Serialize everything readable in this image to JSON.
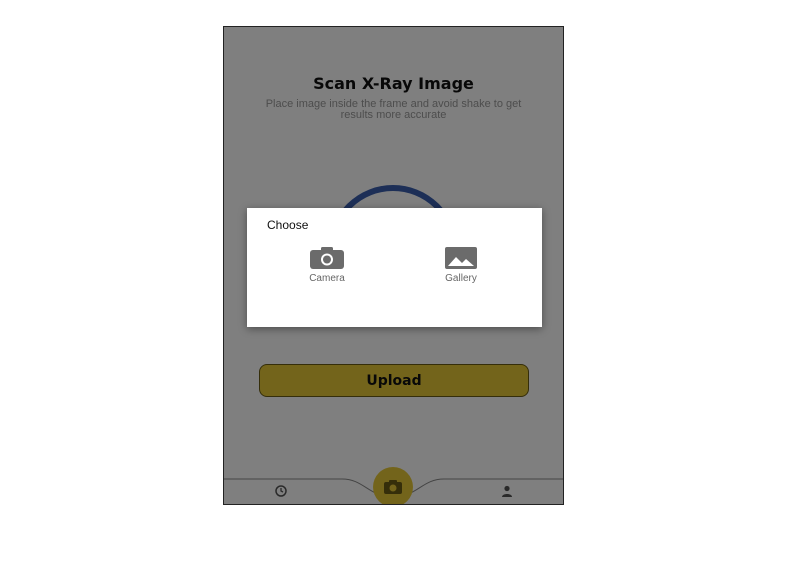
{
  "screen": {
    "title": "Scan X-Ray Image",
    "subtitle": "Place image inside the frame and avoid shake to get results more accurate",
    "upload_label": "Upload"
  },
  "dialog": {
    "title": "Choose",
    "options": [
      {
        "label": "Camera",
        "icon": "camera-icon"
      },
      {
        "label": "Gallery",
        "icon": "image-icon"
      }
    ]
  },
  "nav": {
    "items": [
      {
        "icon": "history-icon"
      },
      {
        "icon": "camera-icon"
      },
      {
        "icon": "person-icon"
      }
    ]
  },
  "colors": {
    "accent": "#e7c936",
    "ring": "#3a5fae",
    "scrim": "rgba(0,0,0,0.5)"
  }
}
